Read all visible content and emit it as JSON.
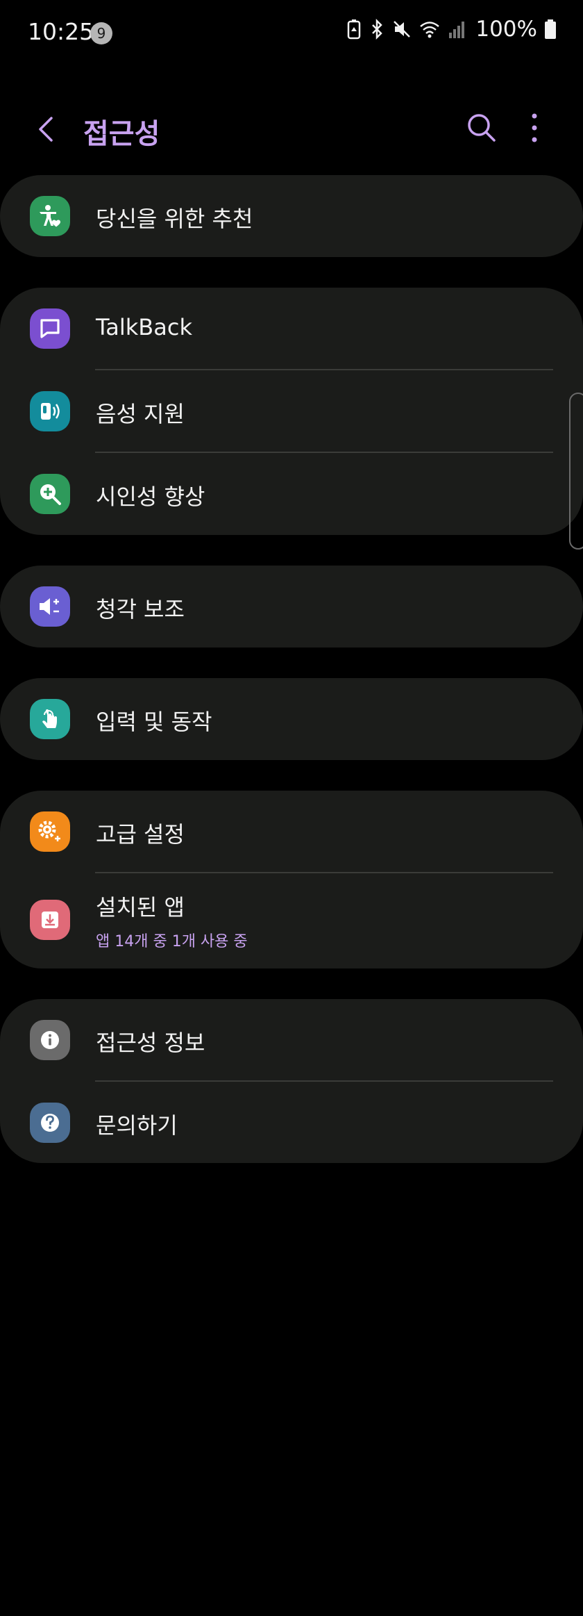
{
  "status_bar": {
    "time": "10:25",
    "notification_count": "9",
    "battery": "100%"
  },
  "header": {
    "title": "접근성"
  },
  "sections": [
    {
      "items": [
        {
          "label": "당신을 위한 추천",
          "icon": "accessibility-heart-icon",
          "color": "#2e9a5b"
        }
      ]
    },
    {
      "items": [
        {
          "label": "TalkBack",
          "icon": "talkback-chat-icon",
          "color": "#7b4fd0"
        },
        {
          "label": "음성 지원",
          "icon": "voice-assistant-icon",
          "color": "#138c9c"
        },
        {
          "label": "시인성 향상",
          "icon": "visibility-zoom-icon",
          "color": "#2e9a5b"
        }
      ]
    },
    {
      "items": [
        {
          "label": "청각 보조",
          "icon": "hearing-volume-icon",
          "color": "#6a5fd2"
        }
      ]
    },
    {
      "items": [
        {
          "label": "입력 및 동작",
          "icon": "touch-hand-icon",
          "color": "#27a89a"
        }
      ]
    },
    {
      "items": [
        {
          "label": "고급 설정",
          "icon": "advanced-gear-icon",
          "color": "#f28a1a"
        },
        {
          "label": "설치된 앱",
          "sublabel": "앱 14개 중 1개 사용 중",
          "icon": "download-app-icon",
          "color": "#e06a78"
        }
      ]
    },
    {
      "items": [
        {
          "label": "접근성 정보",
          "icon": "info-icon",
          "color": "#6b6b6b"
        },
        {
          "label": "문의하기",
          "icon": "help-question-icon",
          "color": "#4b6d92"
        }
      ]
    }
  ]
}
